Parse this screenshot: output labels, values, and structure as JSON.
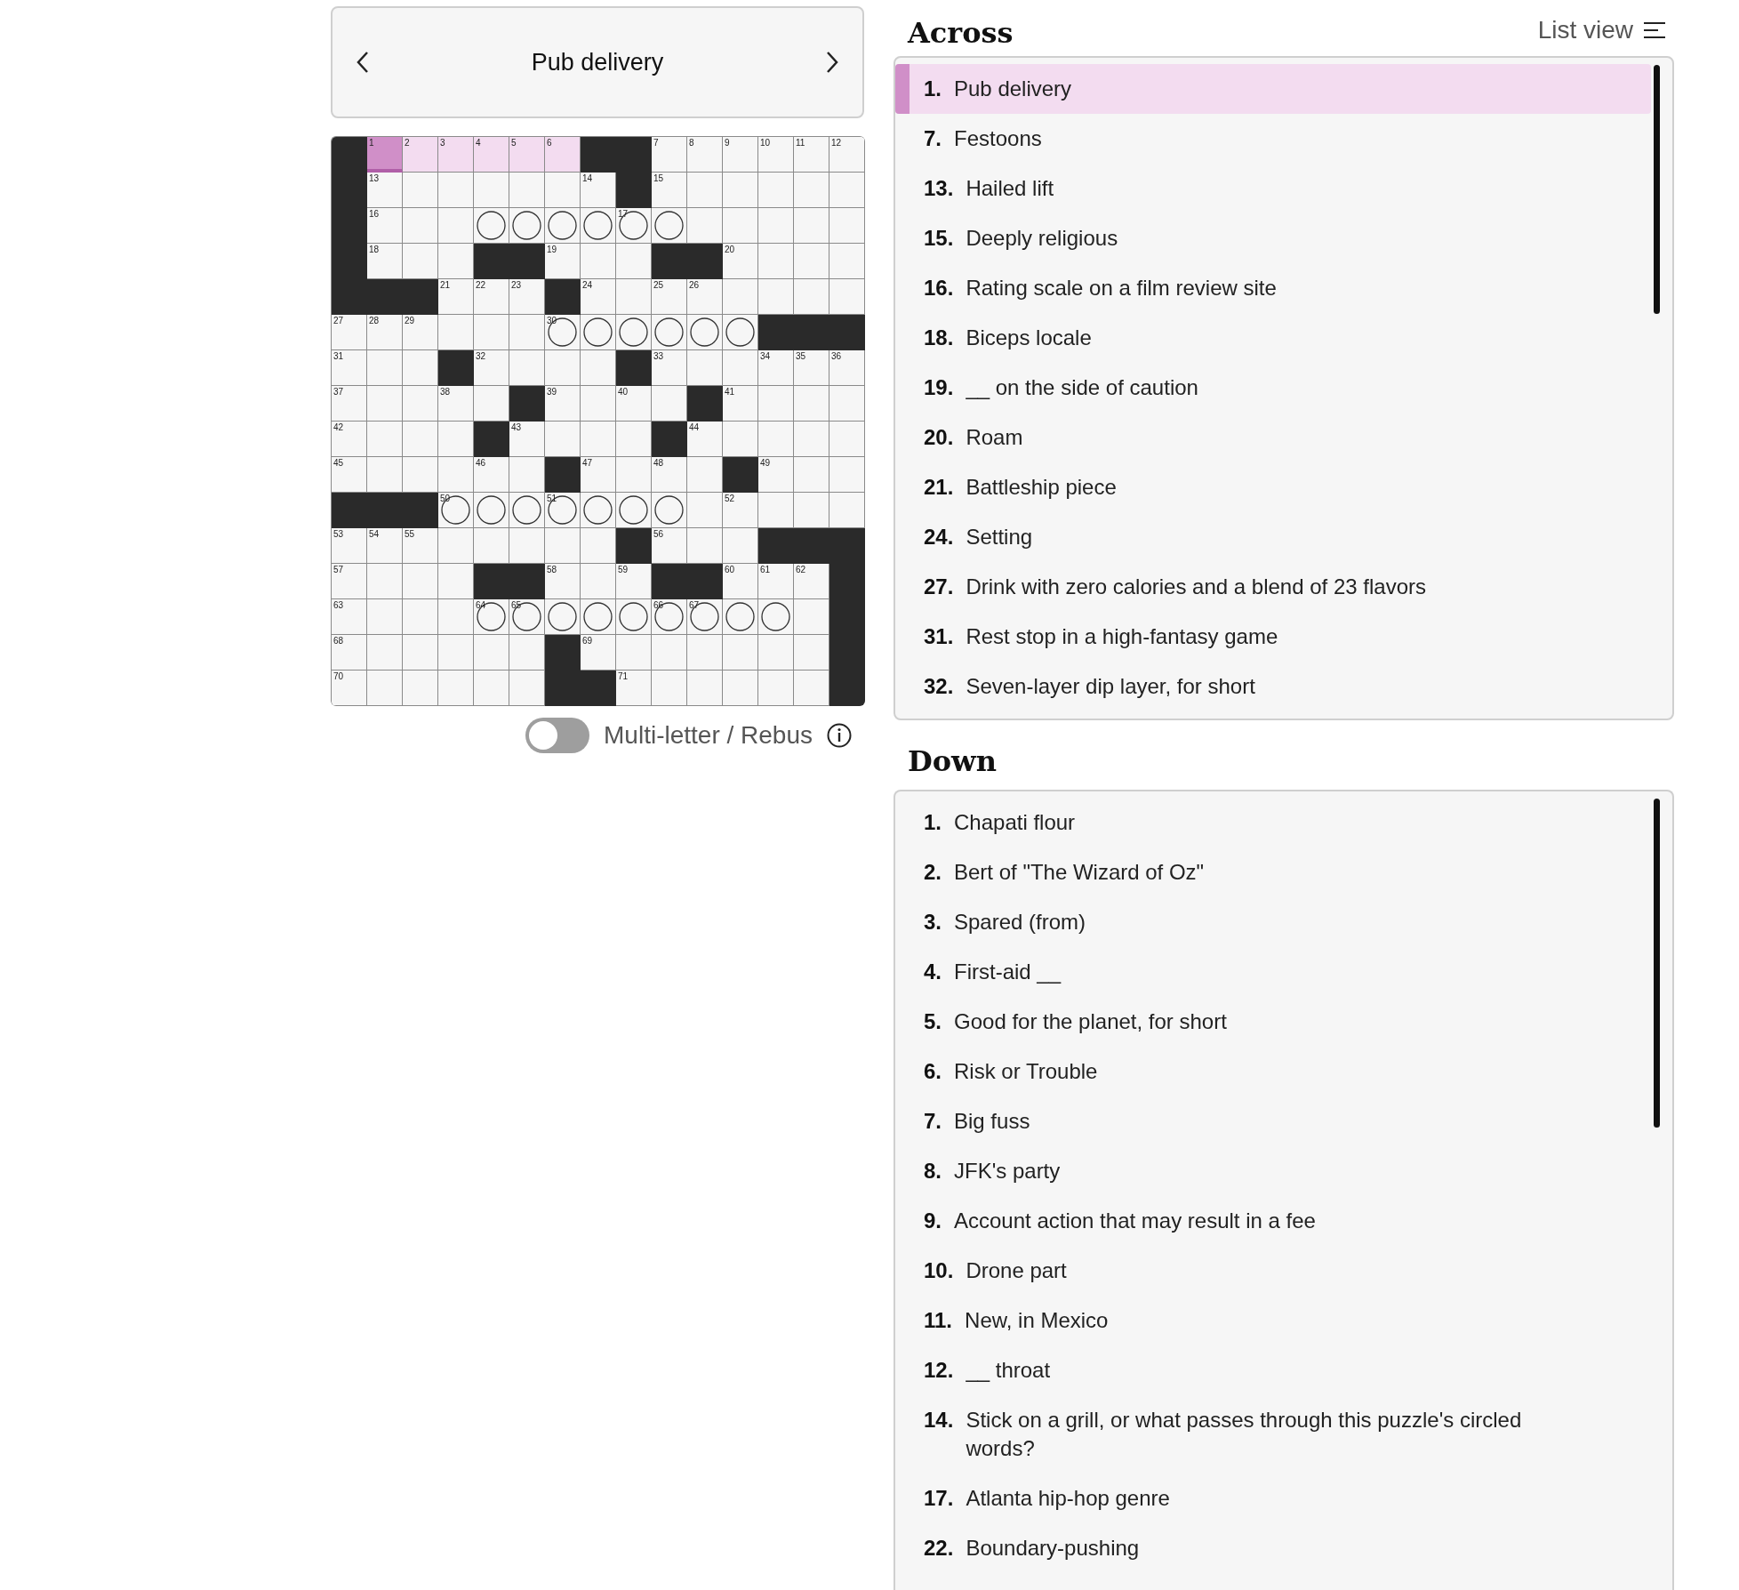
{
  "clue_bar": {
    "text": "Pub delivery"
  },
  "grid": {
    "rows": [
      [
        {
          "kind": "block"
        },
        {
          "kind": "white",
          "number": "1",
          "selected": true,
          "focused": true
        },
        {
          "kind": "white",
          "number": "2",
          "selected": true,
          "focused": false
        },
        {
          "kind": "white",
          "number": "3",
          "selected": true,
          "focused": false
        },
        {
          "kind": "white",
          "number": "4",
          "selected": true,
          "focused": false
        },
        {
          "kind": "white",
          "number": "5",
          "selected": true,
          "focused": false
        },
        {
          "kind": "white",
          "number": "6",
          "selected": true,
          "focused": false
        },
        {
          "kind": "block"
        },
        {
          "kind": "block"
        },
        {
          "kind": "white",
          "number": "7",
          "selected": false,
          "focused": false
        },
        {
          "kind": "white",
          "number": "8",
          "selected": false,
          "focused": false
        },
        {
          "kind": "white",
          "number": "9",
          "selected": false,
          "focused": false
        },
        {
          "kind": "white",
          "number": "10",
          "selected": false,
          "focused": false
        },
        {
          "kind": "white",
          "number": "11",
          "selected": false,
          "focused": false
        },
        {
          "kind": "white",
          "number": "12",
          "selected": false,
          "focused": false
        }
      ],
      [
        {
          "kind": "block"
        },
        {
          "kind": "white",
          "number": "13",
          "selected": false,
          "focused": false
        },
        {
          "kind": "white",
          "selected": false,
          "focused": false
        },
        {
          "kind": "white",
          "selected": false,
          "focused": false
        },
        {
          "kind": "white",
          "selected": false,
          "focused": false
        },
        {
          "kind": "white",
          "selected": false,
          "focused": false
        },
        {
          "kind": "white",
          "selected": false,
          "focused": false
        },
        {
          "kind": "white",
          "number": "14",
          "selected": false,
          "focused": false
        },
        {
          "kind": "block"
        },
        {
          "kind": "white",
          "number": "15",
          "selected": false,
          "focused": false
        },
        {
          "kind": "white",
          "selected": false,
          "focused": false
        },
        {
          "kind": "white",
          "selected": false,
          "focused": false
        },
        {
          "kind": "white",
          "selected": false,
          "focused": false
        },
        {
          "kind": "white",
          "selected": false,
          "focused": false
        },
        {
          "kind": "white",
          "selected": false,
          "focused": false
        }
      ],
      [
        {
          "kind": "block"
        },
        {
          "kind": "white",
          "number": "16",
          "selected": false,
          "focused": false
        },
        {
          "kind": "white",
          "selected": false,
          "focused": false
        },
        {
          "kind": "white",
          "selected": false,
          "focused": false
        },
        {
          "kind": "circle",
          "selected": false,
          "focused": false
        },
        {
          "kind": "circle",
          "selected": false,
          "focused": false
        },
        {
          "kind": "circle",
          "selected": false,
          "focused": false
        },
        {
          "kind": "circle",
          "selected": false,
          "focused": false
        },
        {
          "kind": "circle",
          "number": "17",
          "selected": false,
          "focused": false
        },
        {
          "kind": "circle",
          "selected": false,
          "focused": false
        },
        {
          "kind": "white",
          "selected": false,
          "focused": false
        },
        {
          "kind": "white",
          "selected": false,
          "focused": false
        },
        {
          "kind": "white",
          "selected": false,
          "focused": false
        },
        {
          "kind": "white",
          "selected": false,
          "focused": false
        },
        {
          "kind": "white",
          "selected": false,
          "focused": false
        }
      ],
      [
        {
          "kind": "block"
        },
        {
          "kind": "white",
          "number": "18",
          "selected": false,
          "focused": false
        },
        {
          "kind": "white",
          "selected": false,
          "focused": false
        },
        {
          "kind": "white",
          "selected": false,
          "focused": false
        },
        {
          "kind": "block"
        },
        {
          "kind": "block"
        },
        {
          "kind": "white",
          "number": "19",
          "selected": false,
          "focused": false
        },
        {
          "kind": "white",
          "selected": false,
          "focused": false
        },
        {
          "kind": "white",
          "selected": false,
          "focused": false
        },
        {
          "kind": "block"
        },
        {
          "kind": "block"
        },
        {
          "kind": "white",
          "number": "20",
          "selected": false,
          "focused": false
        },
        {
          "kind": "white",
          "selected": false,
          "focused": false
        },
        {
          "kind": "white",
          "selected": false,
          "focused": false
        },
        {
          "kind": "white",
          "selected": false,
          "focused": false
        }
      ],
      [
        {
          "kind": "block"
        },
        {
          "kind": "block"
        },
        {
          "kind": "block"
        },
        {
          "kind": "white",
          "number": "21",
          "selected": false,
          "focused": false
        },
        {
          "kind": "white",
          "number": "22",
          "selected": false,
          "focused": false
        },
        {
          "kind": "white",
          "number": "23",
          "selected": false,
          "focused": false
        },
        {
          "kind": "block"
        },
        {
          "kind": "white",
          "number": "24",
          "selected": false,
          "focused": false
        },
        {
          "kind": "white",
          "selected": false,
          "focused": false
        },
        {
          "kind": "white",
          "number": "25",
          "selected": false,
          "focused": false
        },
        {
          "kind": "white",
          "number": "26",
          "selected": false,
          "focused": false
        },
        {
          "kind": "white",
          "selected": false,
          "focused": false
        },
        {
          "kind": "white",
          "selected": false,
          "focused": false
        },
        {
          "kind": "white",
          "selected": false,
          "focused": false
        },
        {
          "kind": "white",
          "selected": false,
          "focused": false
        }
      ],
      [
        {
          "kind": "white",
          "number": "27",
          "selected": false,
          "focused": false
        },
        {
          "kind": "white",
          "number": "28",
          "selected": false,
          "focused": false
        },
        {
          "kind": "white",
          "number": "29",
          "selected": false,
          "focused": false
        },
        {
          "kind": "white",
          "selected": false,
          "focused": false
        },
        {
          "kind": "white",
          "selected": false,
          "focused": false
        },
        {
          "kind": "white",
          "selected": false,
          "focused": false
        },
        {
          "kind": "circle",
          "number": "30",
          "selected": false,
          "focused": false
        },
        {
          "kind": "circle",
          "selected": false,
          "focused": false
        },
        {
          "kind": "circle",
          "selected": false,
          "focused": false
        },
        {
          "kind": "circle",
          "selected": false,
          "focused": false
        },
        {
          "kind": "circle",
          "selected": false,
          "focused": false
        },
        {
          "kind": "circle",
          "selected": false,
          "focused": false
        },
        {
          "kind": "block"
        },
        {
          "kind": "block"
        },
        {
          "kind": "block"
        }
      ],
      [
        {
          "kind": "white",
          "number": "31",
          "selected": false,
          "focused": false
        },
        {
          "kind": "white",
          "selected": false,
          "focused": false
        },
        {
          "kind": "white",
          "selected": false,
          "focused": false
        },
        {
          "kind": "block"
        },
        {
          "kind": "white",
          "number": "32",
          "selected": false,
          "focused": false
        },
        {
          "kind": "white",
          "selected": false,
          "focused": false
        },
        {
          "kind": "white",
          "selected": false,
          "focused": false
        },
        {
          "kind": "white",
          "selected": false,
          "focused": false
        },
        {
          "kind": "block"
        },
        {
          "kind": "white",
          "number": "33",
          "selected": false,
          "focused": false
        },
        {
          "kind": "white",
          "selected": false,
          "focused": false
        },
        {
          "kind": "white",
          "selected": false,
          "focused": false
        },
        {
          "kind": "white",
          "number": "34",
          "selected": false,
          "focused": false
        },
        {
          "kind": "white",
          "number": "35",
          "selected": false,
          "focused": false
        },
        {
          "kind": "white",
          "number": "36",
          "selected": false,
          "focused": false
        }
      ],
      [
        {
          "kind": "white",
          "number": "37",
          "selected": false,
          "focused": false
        },
        {
          "kind": "white",
          "selected": false,
          "focused": false
        },
        {
          "kind": "white",
          "selected": false,
          "focused": false
        },
        {
          "kind": "white",
          "number": "38",
          "selected": false,
          "focused": false
        },
        {
          "kind": "white",
          "selected": false,
          "focused": false
        },
        {
          "kind": "block"
        },
        {
          "kind": "white",
          "number": "39",
          "selected": false,
          "focused": false
        },
        {
          "kind": "white",
          "selected": false,
          "focused": false
        },
        {
          "kind": "white",
          "number": "40",
          "selected": false,
          "focused": false
        },
        {
          "kind": "white",
          "selected": false,
          "focused": false
        },
        {
          "kind": "block"
        },
        {
          "kind": "white",
          "number": "41",
          "selected": false,
          "focused": false
        },
        {
          "kind": "white",
          "selected": false,
          "focused": false
        },
        {
          "kind": "white",
          "selected": false,
          "focused": false
        },
        {
          "kind": "white",
          "selected": false,
          "focused": false
        }
      ],
      [
        {
          "kind": "white",
          "number": "42",
          "selected": false,
          "focused": false
        },
        {
          "kind": "white",
          "selected": false,
          "focused": false
        },
        {
          "kind": "white",
          "selected": false,
          "focused": false
        },
        {
          "kind": "white",
          "selected": false,
          "focused": false
        },
        {
          "kind": "block"
        },
        {
          "kind": "white",
          "number": "43",
          "selected": false,
          "focused": false
        },
        {
          "kind": "white",
          "selected": false,
          "focused": false
        },
        {
          "kind": "white",
          "selected": false,
          "focused": false
        },
        {
          "kind": "white",
          "selected": false,
          "focused": false
        },
        {
          "kind": "block"
        },
        {
          "kind": "white",
          "number": "44",
          "selected": false,
          "focused": false
        },
        {
          "kind": "white",
          "selected": false,
          "focused": false
        },
        {
          "kind": "white",
          "selected": false,
          "focused": false
        },
        {
          "kind": "white",
          "selected": false,
          "focused": false
        },
        {
          "kind": "white",
          "selected": false,
          "focused": false
        }
      ],
      [
        {
          "kind": "white",
          "number": "45",
          "selected": false,
          "focused": false
        },
        {
          "kind": "white",
          "selected": false,
          "focused": false
        },
        {
          "kind": "white",
          "selected": false,
          "focused": false
        },
        {
          "kind": "white",
          "selected": false,
          "focused": false
        },
        {
          "kind": "white",
          "number": "46",
          "selected": false,
          "focused": false
        },
        {
          "kind": "white",
          "selected": false,
          "focused": false
        },
        {
          "kind": "block"
        },
        {
          "kind": "white",
          "number": "47",
          "selected": false,
          "focused": false
        },
        {
          "kind": "white",
          "selected": false,
          "focused": false
        },
        {
          "kind": "white",
          "number": "48",
          "selected": false,
          "focused": false
        },
        {
          "kind": "white",
          "selected": false,
          "focused": false
        },
        {
          "kind": "block"
        },
        {
          "kind": "white",
          "number": "49",
          "selected": false,
          "focused": false
        },
        {
          "kind": "white",
          "selected": false,
          "focused": false
        },
        {
          "kind": "white",
          "selected": false,
          "focused": false
        }
      ],
      [
        {
          "kind": "block"
        },
        {
          "kind": "block"
        },
        {
          "kind": "block"
        },
        {
          "kind": "circle",
          "number": "50",
          "selected": false,
          "focused": false
        },
        {
          "kind": "circle",
          "selected": false,
          "focused": false
        },
        {
          "kind": "circle",
          "selected": false,
          "focused": false
        },
        {
          "kind": "circle",
          "number": "51",
          "selected": false,
          "focused": false
        },
        {
          "kind": "circle",
          "selected": false,
          "focused": false
        },
        {
          "kind": "circle",
          "selected": false,
          "focused": false
        },
        {
          "kind": "circle",
          "selected": false,
          "focused": false
        },
        {
          "kind": "white",
          "selected": false,
          "focused": false
        },
        {
          "kind": "white",
          "number": "52",
          "selected": false,
          "focused": false
        },
        {
          "kind": "white",
          "selected": false,
          "focused": false
        },
        {
          "kind": "white",
          "selected": false,
          "focused": false
        },
        {
          "kind": "white",
          "selected": false,
          "focused": false
        }
      ],
      [
        {
          "kind": "white",
          "number": "53",
          "selected": false,
          "focused": false
        },
        {
          "kind": "white",
          "number": "54",
          "selected": false,
          "focused": false
        },
        {
          "kind": "white",
          "number": "55",
          "selected": false,
          "focused": false
        },
        {
          "kind": "white",
          "selected": false,
          "focused": false
        },
        {
          "kind": "white",
          "selected": false,
          "focused": false
        },
        {
          "kind": "white",
          "selected": false,
          "focused": false
        },
        {
          "kind": "white",
          "selected": false,
          "focused": false
        },
        {
          "kind": "white",
          "selected": false,
          "focused": false
        },
        {
          "kind": "block"
        },
        {
          "kind": "white",
          "number": "56",
          "selected": false,
          "focused": false
        },
        {
          "kind": "white",
          "selected": false,
          "focused": false
        },
        {
          "kind": "white",
          "selected": false,
          "focused": false
        },
        {
          "kind": "block"
        },
        {
          "kind": "block"
        },
        {
          "kind": "block"
        }
      ],
      [
        {
          "kind": "white",
          "number": "57",
          "selected": false,
          "focused": false
        },
        {
          "kind": "white",
          "selected": false,
          "focused": false
        },
        {
          "kind": "white",
          "selected": false,
          "focused": false
        },
        {
          "kind": "white",
          "selected": false,
          "focused": false
        },
        {
          "kind": "block"
        },
        {
          "kind": "block"
        },
        {
          "kind": "white",
          "number": "58",
          "selected": false,
          "focused": false
        },
        {
          "kind": "white",
          "selected": false,
          "focused": false
        },
        {
          "kind": "white",
          "number": "59",
          "selected": false,
          "focused": false
        },
        {
          "kind": "block"
        },
        {
          "kind": "block"
        },
        {
          "kind": "white",
          "number": "60",
          "selected": false,
          "focused": false
        },
        {
          "kind": "white",
          "number": "61",
          "selected": false,
          "focused": false
        },
        {
          "kind": "white",
          "number": "62",
          "selected": false,
          "focused": false
        },
        {
          "kind": "block"
        }
      ],
      [
        {
          "kind": "white",
          "number": "63",
          "selected": false,
          "focused": false
        },
        {
          "kind": "white",
          "selected": false,
          "focused": false
        },
        {
          "kind": "white",
          "selected": false,
          "focused": false
        },
        {
          "kind": "white",
          "selected": false,
          "focused": false
        },
        {
          "kind": "circle",
          "number": "64",
          "selected": false,
          "focused": false
        },
        {
          "kind": "circle",
          "number": "65",
          "selected": false,
          "focused": false
        },
        {
          "kind": "circle",
          "selected": false,
          "focused": false
        },
        {
          "kind": "circle",
          "selected": false,
          "focused": false
        },
        {
          "kind": "circle",
          "selected": false,
          "focused": false
        },
        {
          "kind": "circle",
          "number": "66",
          "selected": false,
          "focused": false
        },
        {
          "kind": "circle",
          "number": "67",
          "selected": false,
          "focused": false
        },
        {
          "kind": "circle",
          "selected": false,
          "focused": false
        },
        {
          "kind": "circle",
          "selected": false,
          "focused": false
        },
        {
          "kind": "white",
          "selected": false,
          "focused": false
        },
        {
          "kind": "block"
        }
      ],
      [
        {
          "kind": "white",
          "number": "68",
          "selected": false,
          "focused": false
        },
        {
          "kind": "white",
          "selected": false,
          "focused": false
        },
        {
          "kind": "white",
          "selected": false,
          "focused": false
        },
        {
          "kind": "white",
          "selected": false,
          "focused": false
        },
        {
          "kind": "white",
          "selected": false,
          "focused": false
        },
        {
          "kind": "white",
          "selected": false,
          "focused": false
        },
        {
          "kind": "block"
        },
        {
          "kind": "white",
          "number": "69",
          "selected": false,
          "focused": false
        },
        {
          "kind": "white",
          "selected": false,
          "focused": false
        },
        {
          "kind": "white",
          "selected": false,
          "focused": false
        },
        {
          "kind": "white",
          "selected": false,
          "focused": false
        },
        {
          "kind": "white",
          "selected": false,
          "focused": false
        },
        {
          "kind": "white",
          "selected": false,
          "focused": false
        },
        {
          "kind": "white",
          "selected": false,
          "focused": false
        },
        {
          "kind": "block"
        }
      ],
      [
        {
          "kind": "white",
          "number": "70",
          "selected": false,
          "focused": false
        },
        {
          "kind": "white",
          "selected": false,
          "focused": false
        },
        {
          "kind": "white",
          "selected": false,
          "focused": false
        },
        {
          "kind": "white",
          "selected": false,
          "focused": false
        },
        {
          "kind": "white",
          "selected": false,
          "focused": false
        },
        {
          "kind": "white",
          "selected": false,
          "focused": false
        },
        {
          "kind": "block"
        },
        {
          "kind": "block"
        },
        {
          "kind": "white",
          "number": "71",
          "selected": false,
          "focused": false
        },
        {
          "kind": "white",
          "selected": false,
          "focused": false
        },
        {
          "kind": "white",
          "selected": false,
          "focused": false
        },
        {
          "kind": "white",
          "selected": false,
          "focused": false
        },
        {
          "kind": "white",
          "selected": false,
          "focused": false
        },
        {
          "kind": "white",
          "selected": false,
          "focused": false
        },
        {
          "kind": "block"
        }
      ]
    ]
  },
  "rebus_toggle": {
    "label": "Multi-letter / Rebus",
    "on": false
  },
  "list_view": {
    "label": "List view"
  },
  "across": {
    "title": "Across",
    "clues": [
      {
        "number": "1.",
        "text": "Pub delivery",
        "selected": true
      },
      {
        "number": "7.",
        "text": "Festoons",
        "selected": false
      },
      {
        "number": "13.",
        "text": "Hailed lift",
        "selected": false
      },
      {
        "number": "15.",
        "text": "Deeply religious",
        "selected": false
      },
      {
        "number": "16.",
        "text": "Rating scale on a film review site",
        "selected": false
      },
      {
        "number": "18.",
        "text": "Biceps locale",
        "selected": false
      },
      {
        "number": "19.",
        "text": "__ on the side of caution",
        "selected": false
      },
      {
        "number": "20.",
        "text": "Roam",
        "selected": false
      },
      {
        "number": "21.",
        "text": "Battleship piece",
        "selected": false
      },
      {
        "number": "24.",
        "text": "Setting",
        "selected": false
      },
      {
        "number": "27.",
        "text": "Drink with zero calories and a blend of 23 flavors",
        "selected": false
      },
      {
        "number": "31.",
        "text": "Rest stop in a high-fantasy game",
        "selected": false
      },
      {
        "number": "32.",
        "text": "Seven-layer dip layer, for short",
        "selected": false
      }
    ]
  },
  "down": {
    "title": "Down",
    "clues": [
      {
        "number": "1.",
        "text": "Chapati flour",
        "selected": false
      },
      {
        "number": "2.",
        "text": "Bert of \"The Wizard of Oz\"",
        "selected": false
      },
      {
        "number": "3.",
        "text": "Spared (from)",
        "selected": false
      },
      {
        "number": "4.",
        "text": "First-aid __",
        "selected": false
      },
      {
        "number": "5.",
        "text": "Good for the planet, for short",
        "selected": false
      },
      {
        "number": "6.",
        "text": "Risk or Trouble",
        "selected": false
      },
      {
        "number": "7.",
        "text": "Big fuss",
        "selected": false
      },
      {
        "number": "8.",
        "text": "JFK's party",
        "selected": false
      },
      {
        "number": "9.",
        "text": "Account action that may result in a fee",
        "selected": false
      },
      {
        "number": "10.",
        "text": "Drone part",
        "selected": false
      },
      {
        "number": "11.",
        "text": "New, in Mexico",
        "selected": false
      },
      {
        "number": "12.",
        "text": "__ throat",
        "selected": false
      },
      {
        "number": "14.",
        "text": "Stick on a grill, or what passes through this puzzle's circled words?",
        "selected": false
      },
      {
        "number": "17.",
        "text": "Atlanta hip-hop genre",
        "selected": false
      },
      {
        "number": "22.",
        "text": "Boundary-pushing",
        "selected": false
      }
    ]
  }
}
